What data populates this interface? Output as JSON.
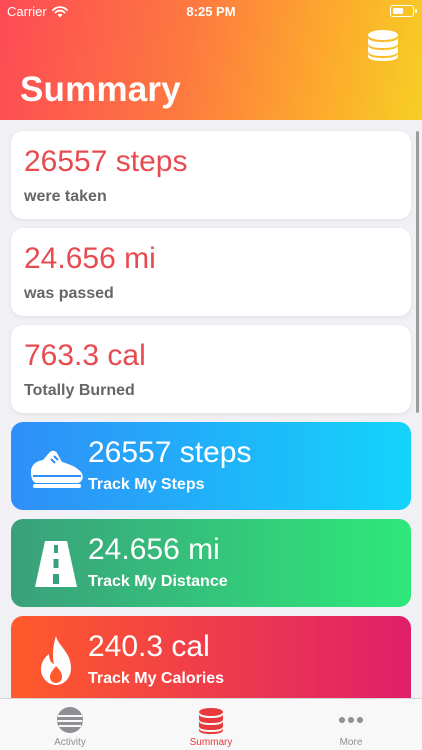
{
  "status_bar": {
    "carrier": "Carrier",
    "time": "8:25 PM",
    "battery_level": 0.6
  },
  "header": {
    "title": "Summary",
    "action_icon": "database-icon"
  },
  "summary_cards": [
    {
      "value": "26557 steps",
      "label": "were taken"
    },
    {
      "value": "24.656 mi",
      "label": "was passed"
    },
    {
      "value": "763.3 cal",
      "label": "Totally Burned"
    }
  ],
  "track_cards": [
    {
      "value": "26557 steps",
      "label": "Track My Steps",
      "icon": "sneaker-icon"
    },
    {
      "value": "24.656 mi",
      "label": "Track My Distance",
      "icon": "road-icon"
    },
    {
      "value": "240.3 cal",
      "label": "Track My Calories",
      "icon": "flame-icon"
    }
  ],
  "tabs": [
    {
      "label": "Activity",
      "icon": "globe-icon"
    },
    {
      "label": "Summary",
      "icon": "database-icon",
      "active": true
    },
    {
      "label": "More",
      "icon": "more-icon"
    }
  ],
  "colors": {
    "accent": "#e84b4f",
    "steps_gradient": [
      "#2f8ef8",
      "#13d4fb"
    ],
    "distance_gradient": [
      "#3aa07b",
      "#2ee87a"
    ],
    "calories_gradient": [
      "#ff5a2b",
      "#e01f6a"
    ]
  }
}
